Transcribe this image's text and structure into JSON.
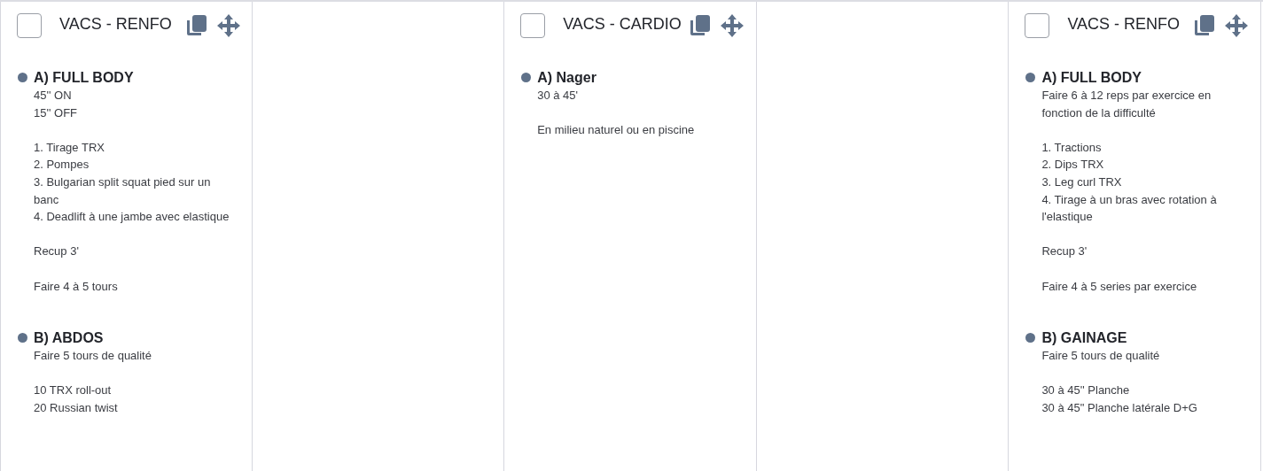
{
  "columns": [
    {
      "kind": "card",
      "title": "VACS - RENFO",
      "checked": false,
      "sections": [
        {
          "title": "A) FULL BODY",
          "paragraphs": [
            [
              "45'' ON",
              "15'' OFF"
            ],
            [
              "1. Tirage TRX",
              "2. Pompes",
              "3. Bulgarian split squat pied sur un banc",
              "4. Deadlift à une jambe avec elastique"
            ],
            [
              "Recup 3'"
            ],
            [
              "Faire 4 à 5 tours"
            ]
          ]
        },
        {
          "title": "B) ABDOS",
          "paragraphs": [
            [
              "Faire 5 tours de qualité"
            ],
            [
              "10 TRX roll-out",
              "20 Russian twist"
            ]
          ]
        }
      ]
    },
    {
      "kind": "empty"
    },
    {
      "kind": "card",
      "title": "VACS - CARDIO",
      "checked": false,
      "sections": [
        {
          "title": "A) Nager",
          "paragraphs": [
            [
              "30 à 45'"
            ],
            [
              "En milieu naturel ou en piscine"
            ]
          ]
        }
      ]
    },
    {
      "kind": "empty"
    },
    {
      "kind": "card",
      "title": "VACS - RENFO",
      "checked": false,
      "sections": [
        {
          "title": "A) FULL BODY",
          "paragraphs": [
            [
              "Faire 6 à 12 reps par exercice en fonction de la difficulté"
            ],
            [
              "1. Tractions",
              "2. Dips TRX",
              "3. Leg curl TRX",
              "4. Tirage à un bras avec rotation à l'elastique"
            ],
            [
              "Recup 3'"
            ],
            [
              "Faire 4 à 5 series par exercice"
            ]
          ]
        },
        {
          "title": "B) GAINAGE",
          "paragraphs": [
            [
              "Faire 5 tours de qualité"
            ],
            [
              "30 à 45'' Planche",
              "30 à 45\" Planche latérale D+G"
            ]
          ]
        }
      ]
    }
  ]
}
